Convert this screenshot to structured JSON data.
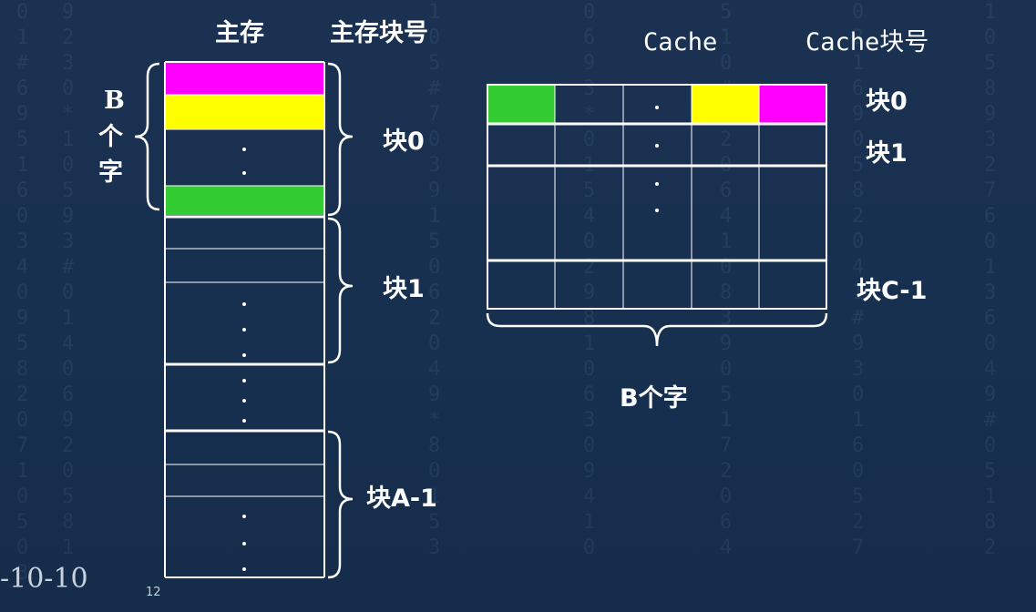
{
  "labels": {
    "main_memory": "主存",
    "main_block_number": "主存块号",
    "cache": "Cache",
    "cache_block_number": "Cache块号",
    "b_words_vertical": [
      "B",
      "个",
      "字"
    ],
    "block0": "块0",
    "block1": "块1",
    "block_a1": "块A-1",
    "cache_block0": "块0",
    "cache_block1": "块1",
    "cache_block_c1": "块C-1",
    "b_words": "B个字"
  },
  "footer": {
    "date": "-10-10",
    "page": "12"
  },
  "colors": {
    "magenta": "#ff00ff",
    "yellow": "#ffff00",
    "green": "#33cc33",
    "line": "#ffffff"
  }
}
